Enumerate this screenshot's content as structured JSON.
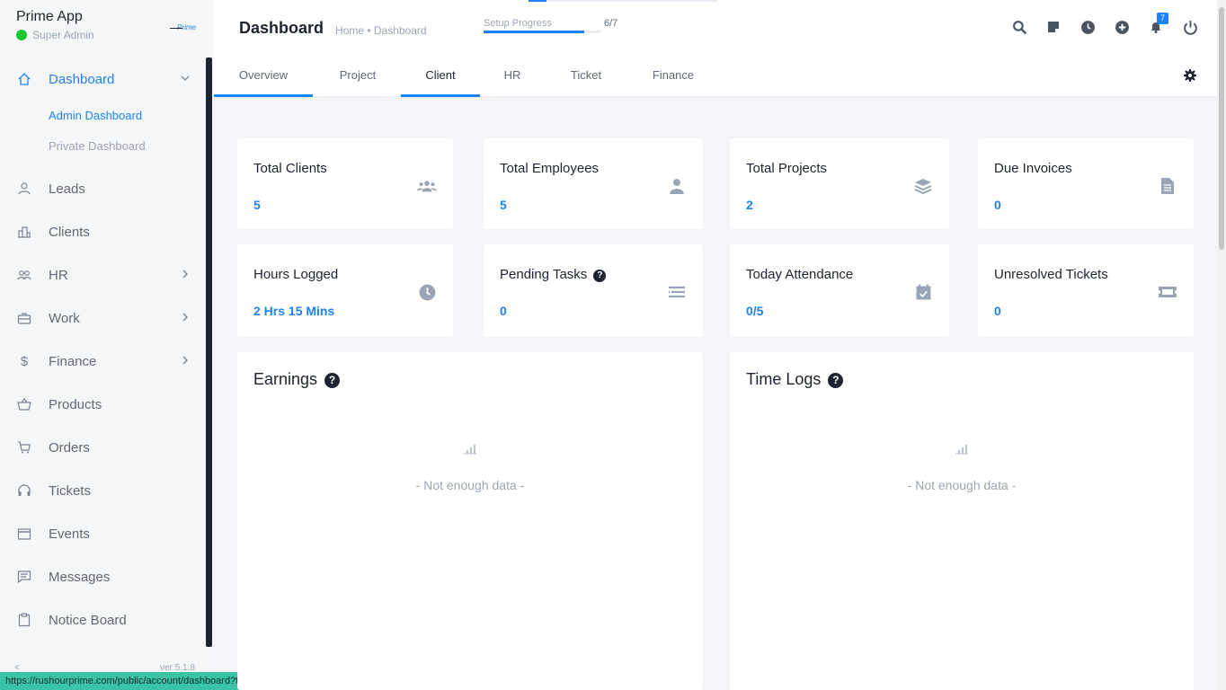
{
  "app": {
    "name": "Prime App",
    "role": "Super Admin",
    "logo_text": "Prime"
  },
  "sidebar": {
    "items": [
      {
        "label": "Dashboard",
        "icon": "home-icon"
      },
      {
        "label": "Leads",
        "icon": "user-icon"
      },
      {
        "label": "Clients",
        "icon": "building-icon"
      },
      {
        "label": "HR",
        "icon": "people-icon"
      },
      {
        "label": "Work",
        "icon": "briefcase-icon"
      },
      {
        "label": "Finance",
        "icon": "dollar-icon"
      },
      {
        "label": "Products",
        "icon": "basket-icon"
      },
      {
        "label": "Orders",
        "icon": "cart-icon"
      },
      {
        "label": "Tickets",
        "icon": "headset-icon"
      },
      {
        "label": "Events",
        "icon": "calendar-icon"
      },
      {
        "label": "Messages",
        "icon": "message-icon"
      },
      {
        "label": "Notice Board",
        "icon": "clipboard-icon"
      }
    ],
    "submenu": [
      "Admin Dashboard",
      "Private Dashboard"
    ],
    "version": "ver 5.1.8",
    "collapse": "<"
  },
  "status_url": "https://rushourprime.com/public/account/dashboard?tab=client",
  "header": {
    "title": "Dashboard",
    "breadcrumb": "Home • Dashboard",
    "setup_label": "Setup Progress",
    "setup_count": "6/7",
    "setup_progress": 0.86,
    "notification_count": "7"
  },
  "tabs": [
    "Overview",
    "Project",
    "Client",
    "HR",
    "Ticket",
    "Finance"
  ],
  "stats": [
    {
      "title": "Total Clients",
      "value": "5",
      "icon": "clients-icon"
    },
    {
      "title": "Total Employees",
      "value": "5",
      "icon": "employee-icon"
    },
    {
      "title": "Total Projects",
      "value": "2",
      "icon": "layers-icon"
    },
    {
      "title": "Due Invoices",
      "value": "0",
      "icon": "invoice-icon"
    },
    {
      "title": "Hours Logged",
      "value": "2 Hrs 15 Mins",
      "icon": "clock-icon"
    },
    {
      "title": "Pending Tasks",
      "value": "0",
      "icon": "tasks-icon"
    },
    {
      "title": "Today Attendance",
      "value": "0/5",
      "icon": "calendar-check-icon"
    },
    {
      "title": "Unresolved Tickets",
      "value": "0",
      "icon": "ticket-icon"
    }
  ],
  "panels": {
    "earnings": {
      "title": "Earnings",
      "empty": "- Not enough data -"
    },
    "timelogs": {
      "title": "Time Logs",
      "empty": "- Not enough data -"
    }
  }
}
